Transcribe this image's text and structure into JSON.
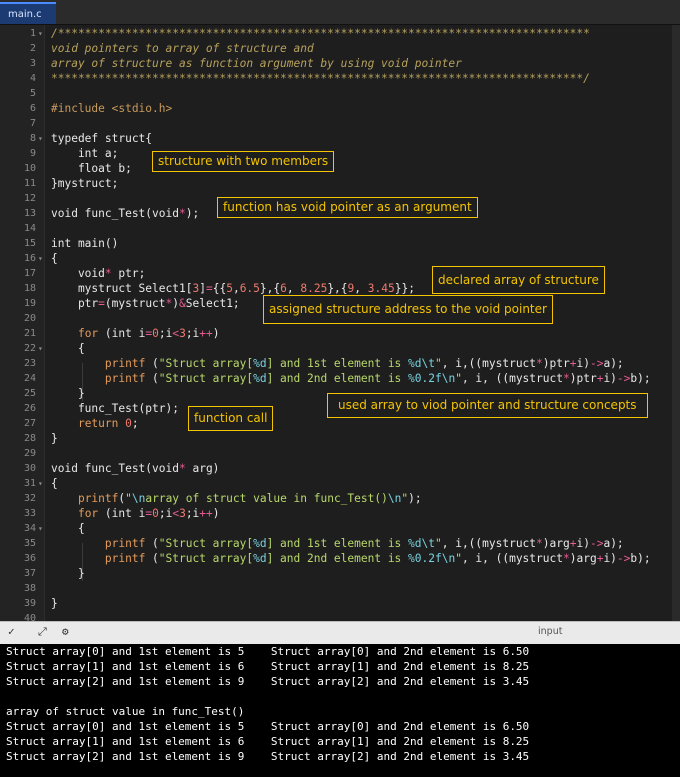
{
  "tab": {
    "filename": "main.c"
  },
  "lines": [
    {
      "n": "1",
      "fold": "▾",
      "html": "<span class='c-com'>/*******************************************************************************</span>"
    },
    {
      "n": "2",
      "fold": "",
      "html": "<span class='c-com'>void pointers to array of structure and</span>"
    },
    {
      "n": "3",
      "fold": "",
      "html": "<span class='c-com'>array of structure as function argument by using void pointer</span>"
    },
    {
      "n": "4",
      "fold": "",
      "html": "<span class='c-com'>*******************************************************************************/</span>"
    },
    {
      "n": "5",
      "fold": "",
      "html": ""
    },
    {
      "n": "6",
      "fold": "",
      "html": "<span class='c-pp'>#include &lt;stdio.h&gt;</span>"
    },
    {
      "n": "7",
      "fold": "",
      "html": ""
    },
    {
      "n": "8",
      "fold": "▾",
      "html": "typedef struct{"
    },
    {
      "n": "9",
      "fold": "",
      "html": "    int a;"
    },
    {
      "n": "10",
      "fold": "",
      "html": "    float b;"
    },
    {
      "n": "11",
      "fold": "",
      "html": "}mystruct;"
    },
    {
      "n": "12",
      "fold": "",
      "html": ""
    },
    {
      "n": "13",
      "fold": "",
      "html": "void func_Test(void<span class='c-op'>*</span>);"
    },
    {
      "n": "14",
      "fold": "",
      "html": ""
    },
    {
      "n": "15",
      "fold": "",
      "html": "int main()"
    },
    {
      "n": "16",
      "fold": "▾",
      "html": "{"
    },
    {
      "n": "17",
      "fold": "",
      "html": "    void<span class='c-op'>*</span> ptr;"
    },
    {
      "n": "18",
      "fold": "",
      "html": "    mystruct Select1[<span class='c-num'>3</span>]<span class='c-op'>=</span>{{<span class='c-num'>5</span>,<span class='c-num'>6.5</span>},{<span class='c-num'>6</span>, <span class='c-num'>8.25</span>},{<span class='c-num'>9</span>, <span class='c-num'>3.45</span>}};"
    },
    {
      "n": "19",
      "fold": "",
      "html": "    ptr<span class='c-op'>=</span>(mystruct<span class='c-op'>*</span>)<span class='c-op'>&amp;</span>Select1;"
    },
    {
      "n": "20",
      "fold": "",
      "html": ""
    },
    {
      "n": "21",
      "fold": "",
      "html": "    <span class='c-kw'>for</span> (int i<span class='c-op'>=</span><span class='c-num'>0</span>;i<span class='c-op'>&lt;</span><span class='c-num'>3</span>;i<span class='c-op'>++</span>)"
    },
    {
      "n": "22",
      "fold": "▾",
      "html": "    {"
    },
    {
      "n": "23",
      "fold": "",
      "html": "        <span class='c-kw'>printf</span> (<span class='c-str'>\"Struct array[</span><span class='c-esc'>%d</span><span class='c-str'>] and 1st element is </span><span class='c-esc'>%d\\t</span><span class='c-str'>\"</span>, i,((mystruct<span class='c-op'>*</span>)ptr<span class='c-op'>+</span>i)<span class='c-op'>-&gt;</span>a);"
    },
    {
      "n": "24",
      "fold": "",
      "html": "        <span class='c-kw'>printf</span> (<span class='c-str'>\"Struct array[</span><span class='c-esc'>%d</span><span class='c-str'>] and 2nd element is </span><span class='c-esc'>%0.2f\\n</span><span class='c-str'>\"</span>, i, ((mystruct<span class='c-op'>*</span>)ptr<span class='c-op'>+</span>i)<span class='c-op'>-&gt;</span>b);"
    },
    {
      "n": "25",
      "fold": "",
      "html": "    }"
    },
    {
      "n": "26",
      "fold": "",
      "html": "    func_Test(ptr);"
    },
    {
      "n": "27",
      "fold": "",
      "html": "    <span class='c-kw'>return</span> <span class='c-num'>0</span>;"
    },
    {
      "n": "28",
      "fold": "",
      "html": "}"
    },
    {
      "n": "29",
      "fold": "",
      "html": ""
    },
    {
      "n": "30",
      "fold": "",
      "html": "void func_Test(void<span class='c-op'>*</span> arg)"
    },
    {
      "n": "31",
      "fold": "▾",
      "html": "{"
    },
    {
      "n": "32",
      "fold": "",
      "html": "    <span class='c-kw'>printf</span>(<span class='c-str'>\"</span><span class='c-esc'>\\n</span><span class='c-str'>array of struct value in func_Test()</span><span class='c-esc'>\\n</span><span class='c-str'>\"</span>);"
    },
    {
      "n": "33",
      "fold": "",
      "html": "    <span class='c-kw'>for</span> (int i<span class='c-op'>=</span><span class='c-num'>0</span>;i<span class='c-op'>&lt;</span><span class='c-num'>3</span>;i<span class='c-op'>++</span>)"
    },
    {
      "n": "34",
      "fold": "▾",
      "html": "    {"
    },
    {
      "n": "35",
      "fold": "",
      "html": "        <span class='c-kw'>printf</span> (<span class='c-str'>\"Struct array[</span><span class='c-esc'>%d</span><span class='c-str'>] and 1st element is </span><span class='c-esc'>%d\\t</span><span class='c-str'>\"</span>, i,((mystruct<span class='c-op'>*</span>)arg<span class='c-op'>+</span>i)<span class='c-op'>-&gt;</span>a);"
    },
    {
      "n": "36",
      "fold": "",
      "html": "        <span class='c-kw'>printf</span> (<span class='c-str'>\"Struct array[</span><span class='c-esc'>%d</span><span class='c-str'>] and 2nd element is </span><span class='c-esc'>%0.2f\\n</span><span class='c-str'>\"</span>, i, ((mystruct<span class='c-op'>*</span>)arg<span class='c-op'>+</span>i)<span class='c-op'>-&gt;</span>b);"
    },
    {
      "n": "37",
      "fold": "",
      "html": "    }"
    },
    {
      "n": "38",
      "fold": "",
      "html": ""
    },
    {
      "n": "39",
      "fold": "",
      "html": "}"
    },
    {
      "n": "40",
      "fold": "",
      "html": ""
    }
  ],
  "annotations": {
    "struct_members": "structure with two members",
    "void_arg": "function has void pointer as an argument",
    "declared_array": "declared array of structure",
    "assigned_address": "assigned structure address to the void pointer",
    "used_array": "used array to viod pointer and structure concepts",
    "function_call": "function call"
  },
  "io": {
    "input_label": "input",
    "icons": [
      "chevron-down-icon",
      "expand-icon",
      "settings-icon"
    ]
  },
  "console_lines": [
    "Struct array[0] and 1st element is 5    Struct array[0] and 2nd element is 6.50",
    "Struct array[1] and 1st element is 6    Struct array[1] and 2nd element is 8.25",
    "Struct array[2] and 1st element is 9    Struct array[2] and 2nd element is 3.45",
    "",
    "array of struct value in func_Test()",
    "Struct array[0] and 1st element is 5    Struct array[0] and 2nd element is 6.50",
    "Struct array[1] and 1st element is 6    Struct array[1] and 2nd element is 8.25",
    "Struct array[2] and 1st element is 9    Struct array[2] and 2nd element is 3.45"
  ]
}
